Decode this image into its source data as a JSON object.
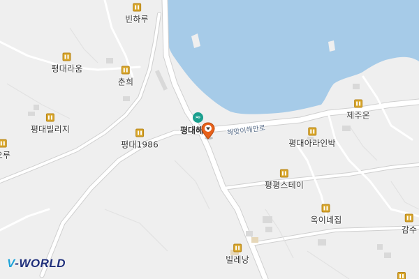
{
  "map": {
    "colors": {
      "water": "#a6cbe8",
      "land": "#efefef",
      "road": "#ffffff",
      "road_edge": "#cfcfcf",
      "building": "#d9d9d9",
      "poi_icon": "#d8a62a",
      "beach_icon": "#1a9f8e",
      "pin": "#e8611a"
    },
    "pois": [
      {
        "id": "binharu",
        "label": "빈하루"
      },
      {
        "id": "pyeongdae-raum",
        "label": "평대라움"
      },
      {
        "id": "chunhui",
        "label": "춘희"
      },
      {
        "id": "pyeongdae-villige",
        "label": "평대빌리지"
      },
      {
        "id": "pyeongdae-1986",
        "label": "평대1986"
      },
      {
        "id": "oru",
        "label": "오루"
      },
      {
        "id": "jejuon",
        "label": "제주온"
      },
      {
        "id": "pyeongdae-arainbak",
        "label": "평대아라인박"
      },
      {
        "id": "pyeongpyeong-stay",
        "label": "평평스테이"
      },
      {
        "id": "okinejip",
        "label": "옥이네집"
      },
      {
        "id": "gamsu",
        "label": "감수"
      },
      {
        "id": "billenang",
        "label": "빌레낭"
      }
    ],
    "beach": {
      "label": "평대해",
      "icon": "beach-icon"
    },
    "road_label": "해맞이해안로",
    "selected_pin": {
      "icon": "location-pin-icon"
    },
    "logo": {
      "prefix": "V",
      "text": "-WORLD"
    }
  }
}
